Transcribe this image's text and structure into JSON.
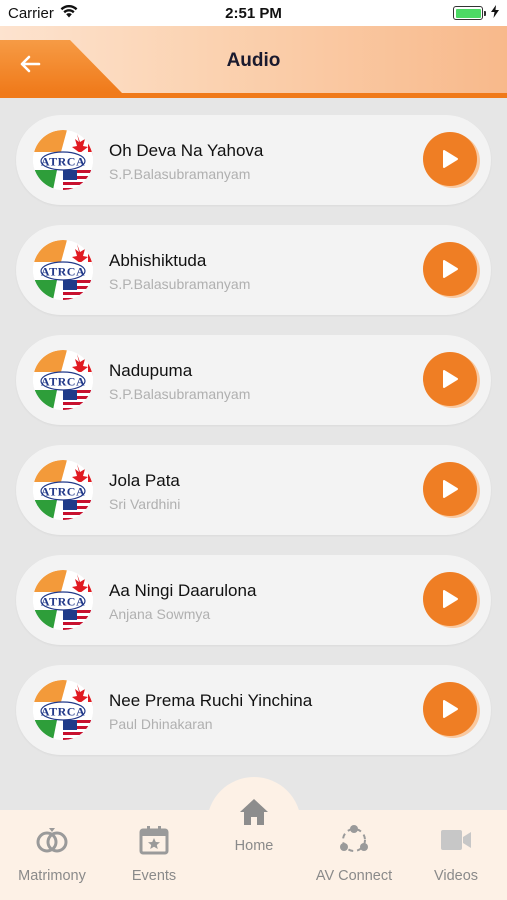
{
  "status_bar": {
    "carrier": "Carrier",
    "time": "2:51 PM"
  },
  "header": {
    "title": "Audio",
    "back_icon": "arrow-left-icon"
  },
  "colors": {
    "accent": "#ef7e24",
    "header_bar": "#f07a1a",
    "background": "#e6e6e6",
    "card": "#f3f3f3",
    "nav_bg": "#fdf1e6"
  },
  "logo_text": "ATRCA",
  "songs": [
    {
      "title": "Oh Deva Na Yahova",
      "artist": "S.P.Balasubramanyam"
    },
    {
      "title": "Abhishiktuda",
      "artist": "S.P.Balasubramanyam"
    },
    {
      "title": "Nadupuma",
      "artist": "S.P.Balasubramanyam"
    },
    {
      "title": "Jola Pata",
      "artist": "Sri Vardhini"
    },
    {
      "title": "Aa Ningi Daarulona",
      "artist": "Anjana Sowmya"
    },
    {
      "title": "Nee Prema Ruchi Yinchina",
      "artist": "Paul Dhinakaran"
    }
  ],
  "bottom_nav": [
    {
      "label": "Matrimony",
      "icon": "rings-icon"
    },
    {
      "label": "Events",
      "icon": "calendar-star-icon"
    },
    {
      "label": "Home",
      "icon": "home-icon"
    },
    {
      "label": "AV Connect",
      "icon": "share-network-icon"
    },
    {
      "label": "Videos",
      "icon": "video-camera-icon"
    }
  ]
}
